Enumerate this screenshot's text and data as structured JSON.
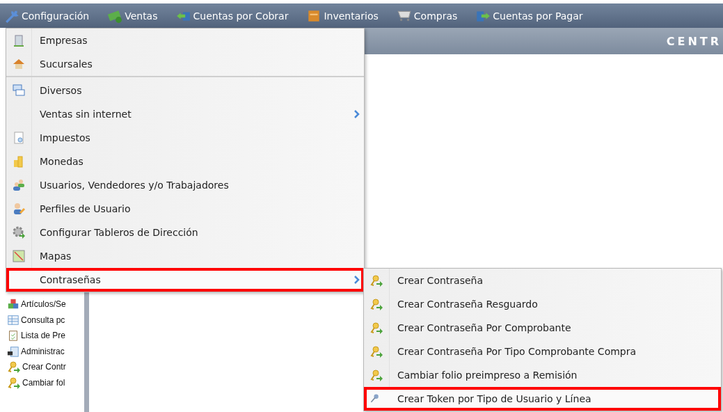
{
  "menubar": [
    {
      "label": "Configuración"
    },
    {
      "label": "Ventas"
    },
    {
      "label": "Cuentas por Cobrar"
    },
    {
      "label": "Inventarios"
    },
    {
      "label": "Compras"
    },
    {
      "label": "Cuentas por Pagar"
    }
  ],
  "header": {
    "title": "CENTR"
  },
  "sidebar": {
    "items": [
      {
        "label": "Artículos/Se"
      },
      {
        "label": "Consulta pc"
      },
      {
        "label": "Lista de Pre"
      },
      {
        "label": "Administrac"
      },
      {
        "label": "Crear Contr"
      },
      {
        "label": "Cambiar fol"
      }
    ]
  },
  "dropdown": {
    "items": [
      {
        "label": "Empresas",
        "has_submenu": false,
        "highlighted": false,
        "separator_after": false
      },
      {
        "label": "Sucursales",
        "has_submenu": false,
        "highlighted": false,
        "separator_after": true
      },
      {
        "label": "Diversos",
        "has_submenu": false,
        "highlighted": false,
        "separator_after": false
      },
      {
        "label": "Ventas sin internet",
        "has_submenu": true,
        "highlighted": false,
        "separator_after": false
      },
      {
        "label": "Impuestos",
        "has_submenu": false,
        "highlighted": false,
        "separator_after": false
      },
      {
        "label": "Monedas",
        "has_submenu": false,
        "highlighted": false,
        "separator_after": false
      },
      {
        "label": "Usuarios, Vendedores y/o Trabajadores",
        "has_submenu": false,
        "highlighted": false,
        "separator_after": false
      },
      {
        "label": "Perfiles de Usuario",
        "has_submenu": false,
        "highlighted": false,
        "separator_after": false
      },
      {
        "label": "Configurar Tableros de Dirección",
        "has_submenu": false,
        "highlighted": false,
        "separator_after": false
      },
      {
        "label": "Mapas",
        "has_submenu": false,
        "highlighted": false,
        "separator_after": false
      },
      {
        "label": "Contraseñas",
        "has_submenu": true,
        "highlighted": true,
        "separator_after": false
      }
    ]
  },
  "submenu": {
    "items": [
      {
        "label": "Crear Contraseña",
        "highlighted": false
      },
      {
        "label": "Crear Contraseña Resguardo",
        "highlighted": false
      },
      {
        "label": "Crear Contraseña Por Comprobante",
        "highlighted": false
      },
      {
        "label": "Crear Contraseña Por Tipo Comprobante Compra",
        "highlighted": false
      },
      {
        "label": "Cambiar folio preimpreso a Remisión",
        "highlighted": false
      },
      {
        "label": "Crear Token por Tipo de Usuario y Línea",
        "highlighted": true
      }
    ]
  }
}
